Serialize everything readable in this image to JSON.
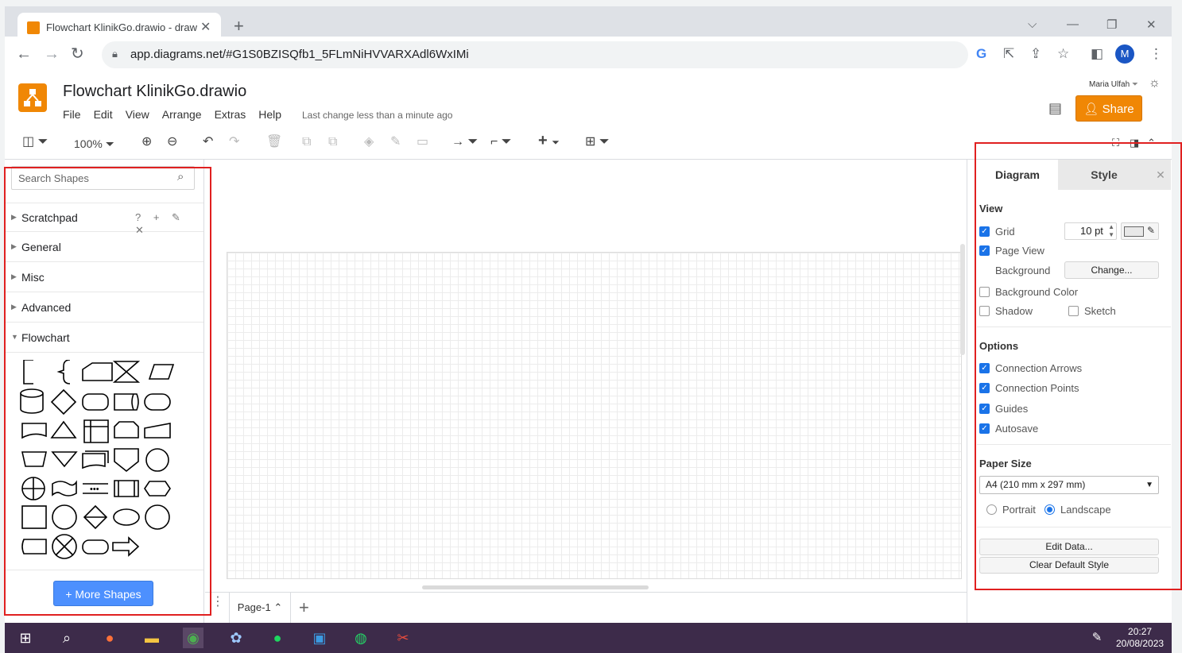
{
  "browser": {
    "tab_title": "Flowchart KlinikGo.drawio - draw",
    "tab_close": "✕",
    "new_tab": "+",
    "url": "app.diagrams.net/#G1S0BZISQfb1_5FLmNiHVVARXAdl6WxIMi",
    "profile_initial": "M"
  },
  "app": {
    "title": "Flowchart KlinikGo.drawio",
    "menu": [
      "File",
      "Edit",
      "View",
      "Arrange",
      "Extras",
      "Help"
    ],
    "last_change": "Last change less than a minute ago",
    "user": "Maria Ulfah",
    "share_label": "Share"
  },
  "toolbar": {
    "zoom": "100%"
  },
  "left_panel": {
    "search_placeholder": "Search Shapes",
    "sections": [
      "Scratchpad",
      "General",
      "Misc",
      "Advanced",
      "Flowchart"
    ],
    "scratchpad_icons": "? + ✎ ✕",
    "more_shapes": "+ More Shapes"
  },
  "page_tabs": {
    "current": "Page-1 ⌃",
    "add": "+"
  },
  "right_panel": {
    "tab_diagram": "Diagram",
    "tab_style": "Style",
    "view_heading": "View",
    "grid": "Grid",
    "grid_size": "10 pt",
    "page_view": "Page View",
    "background": "Background",
    "change": "Change...",
    "background_color": "Background Color",
    "shadow": "Shadow",
    "sketch": "Sketch",
    "options_heading": "Options",
    "connection_arrows": "Connection Arrows",
    "connection_points": "Connection Points",
    "guides": "Guides",
    "autosave": "Autosave",
    "paper_size_heading": "Paper Size",
    "paper_size": "A4 (210 mm x 297 mm)",
    "portrait": "Portrait",
    "landscape": "Landscape",
    "edit_data": "Edit Data...",
    "clear_default_style": "Clear Default Style"
  },
  "taskbar": {
    "time": "20:27",
    "date": "20/08/2023"
  },
  "colors": {
    "accent": "#f08705",
    "more_shapes_blue": "#4d90fe",
    "annotation_red": "#e02020"
  }
}
